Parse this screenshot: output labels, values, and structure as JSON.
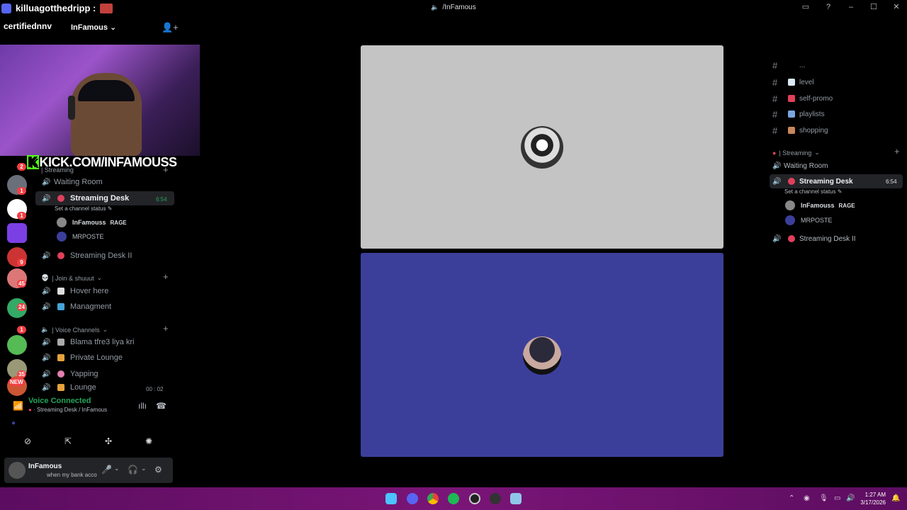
{
  "window": {
    "title": "/InFamous"
  },
  "overlay": {
    "chat_user": "killuagotthedripp :",
    "chat_user2": "certifiednnv",
    "server_name": "InFamous",
    "kick_url": "KICK.COM/INFAMOUSS"
  },
  "left": {
    "partial_category": "| Streaming",
    "channels": {
      "waiting": "Waiting Room",
      "desk": "Streaming Desk",
      "desk_timer": "6:54",
      "desk_status": "Set a channel status",
      "desk2": "Streaming Desk II",
      "hover": "Hover here",
      "managment": "Managment",
      "blama": "Blama tfre3 liya kri",
      "private": "Private Lounge",
      "yapping": "Yapping",
      "lounge": "Lounge",
      "lounge_timer": "00 : 02"
    },
    "members": {
      "m1": "InFamouss",
      "m1_tag": "RAGE",
      "m2": "MRPOSTE"
    },
    "categories": {
      "join": "| Join & shuuut",
      "voice": "| Voice Channels"
    },
    "rail_badges": [
      "2",
      "1",
      "1",
      "9",
      "45",
      "24",
      "1",
      "35",
      "NEW"
    ]
  },
  "voice_panel": {
    "title": "Voice Connected",
    "subtitle": "Streaming Desk / InFamous"
  },
  "user": {
    "name": "InFamous",
    "status": "when my bank acco"
  },
  "right": {
    "channels": {
      "partial": "...",
      "level": "level",
      "self_promo": "self-promo",
      "playlists": "playlists",
      "shopping": "shopping"
    },
    "category_streaming": "| Streaming",
    "waiting": "Waiting Room",
    "desk": "Streaming Desk",
    "desk_timer": "6:54",
    "desk_status": "Set a channel status",
    "m1": "InFamouss",
    "m1_tag": "RAGE",
    "m2": "MRPOSTE",
    "desk2": "Streaming Desk II"
  },
  "taskbar": {
    "time": "1:27 AM",
    "date": "3/17/2026"
  },
  "colors": {
    "accent_green": "#23a55a",
    "tile_top": "#c4c4c4",
    "tile_bottom": "#3c3f9a",
    "taskbar": "#7a1577"
  }
}
